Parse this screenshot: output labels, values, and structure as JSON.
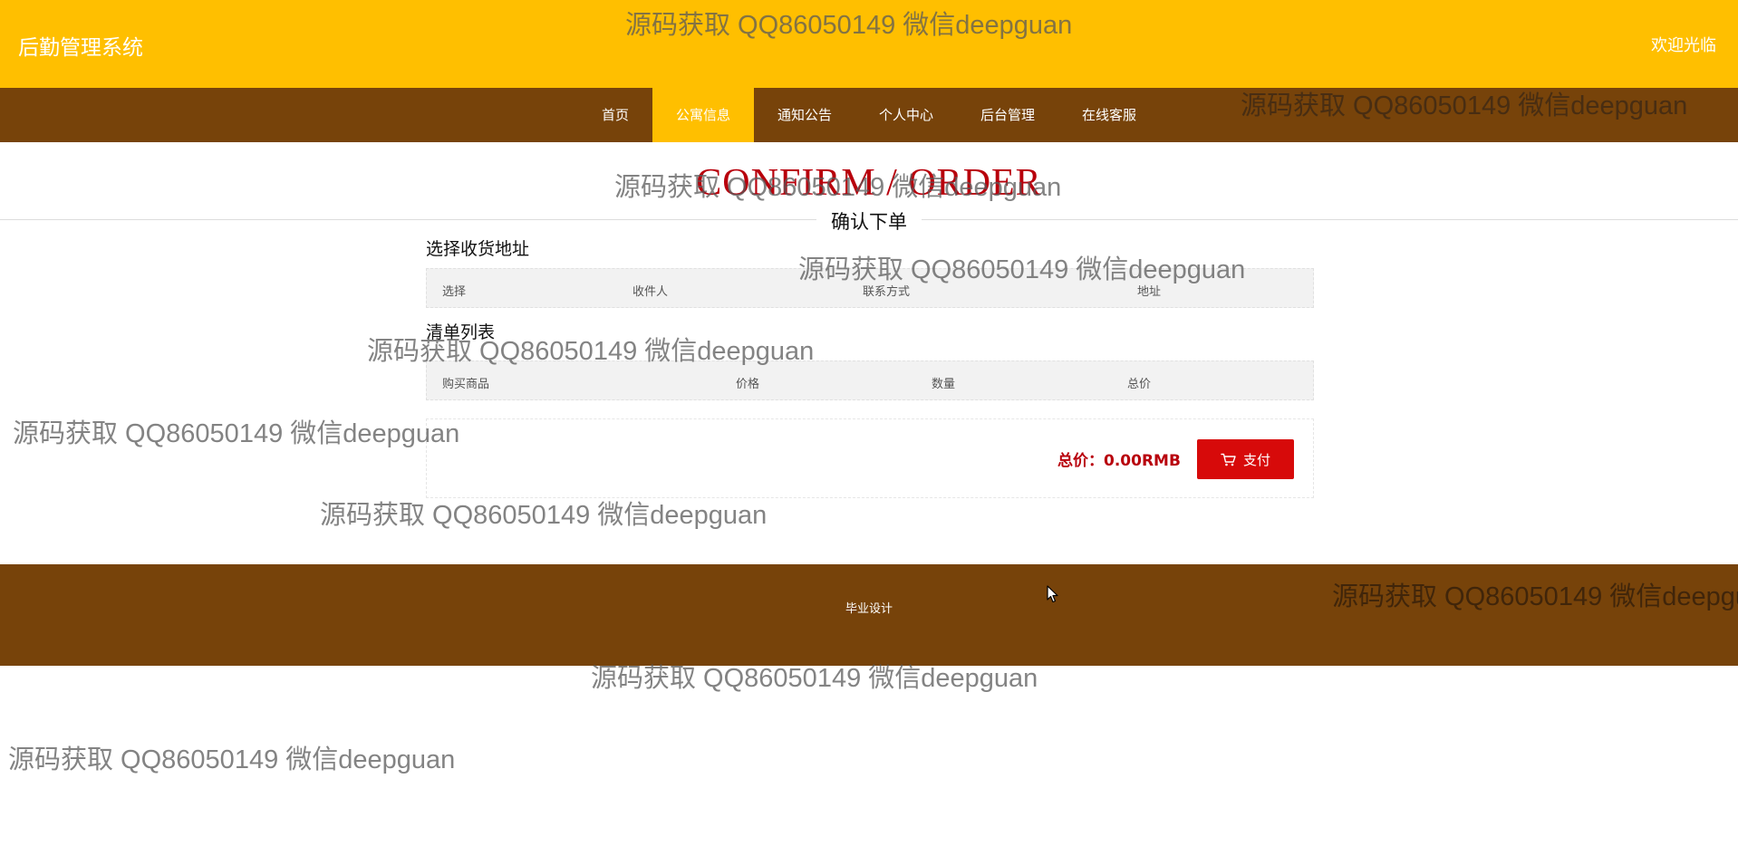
{
  "header": {
    "site_title": "后勤管理系统",
    "welcome": "欢迎光临"
  },
  "nav": {
    "items": [
      {
        "label": "首页"
      },
      {
        "label": "公寓信息"
      },
      {
        "label": "通知公告"
      },
      {
        "label": "个人中心"
      },
      {
        "label": "后台管理"
      },
      {
        "label": "在线客服"
      }
    ],
    "active_index": 1
  },
  "hero": {
    "title_en": "CONFIRM / ORDER",
    "title_cn": "确认下单"
  },
  "address_section": {
    "title": "选择收货地址",
    "columns": [
      "选择",
      "收件人",
      "联系方式",
      "地址"
    ]
  },
  "order_section": {
    "title": "清单列表",
    "columns": [
      "购买商品",
      "价格",
      "数量",
      "总价"
    ]
  },
  "summary": {
    "total_label": "总价：0.00RMB",
    "pay_label": "支付",
    "pay_icon": "cart-icon"
  },
  "footer": {
    "text": "毕业设计"
  },
  "watermark": {
    "text": "源码获取 QQ86050149 微信deepguan"
  },
  "colors": {
    "header_bg": "#FFBF00",
    "nav_bg": "#77430A",
    "accent_red": "#B8000C",
    "pay_button": "#D70A0A"
  }
}
